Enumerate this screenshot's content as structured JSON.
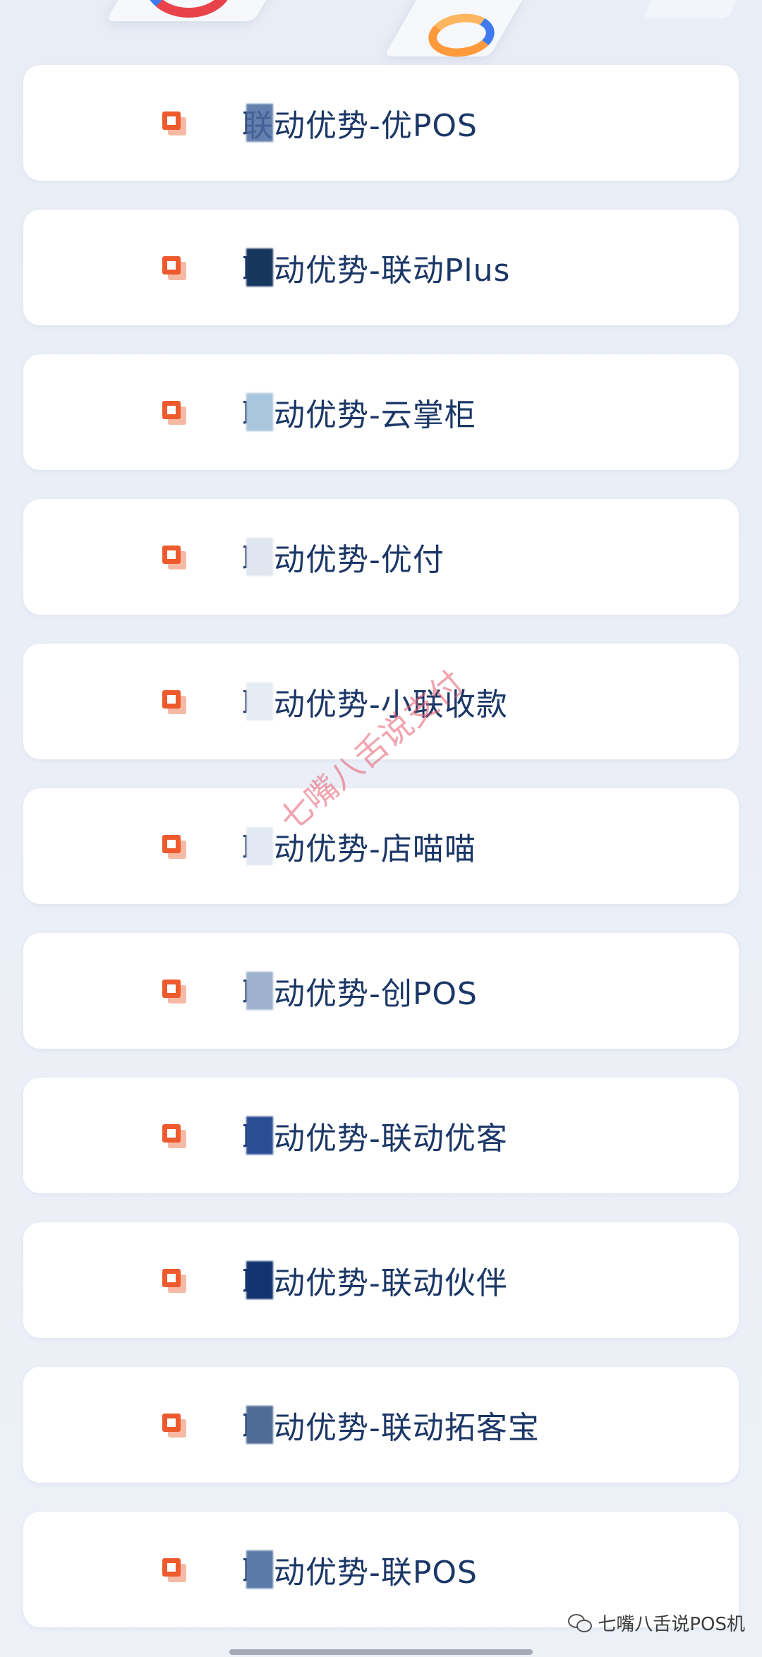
{
  "items": [
    {
      "label": "联动优势-优POS",
      "mosaic": "#4a6aa0"
    },
    {
      "label": "联动优势-联动Plus",
      "mosaic": "#16365e"
    },
    {
      "label": "联动优势-云掌柜",
      "mosaic": "#a8c6de"
    },
    {
      "label": "联动优势-优付",
      "mosaic": "#dfe6ef"
    },
    {
      "label": "联动优势-小联收款",
      "mosaic": "#e6ecf4"
    },
    {
      "label": "联动优势-店喵喵",
      "mosaic": "#e2e9f2"
    },
    {
      "label": "联动优势-创POS",
      "mosaic": "#9eb2cf"
    },
    {
      "label": "联动优势-联动优客",
      "mosaic": "#2b4d94"
    },
    {
      "label": "联动优势-联动伙伴",
      "mosaic": "#13336f"
    },
    {
      "label": "联动优势-联动拓客宝",
      "mosaic": "#4e6c96"
    },
    {
      "label": "联动优势-联POS",
      "mosaic": "#5a7aa8"
    }
  ],
  "watermark": "七嘴八舌说支付",
  "footer_credit": "七嘴八舌说POS机",
  "icon_name": "square-bullet-icon"
}
